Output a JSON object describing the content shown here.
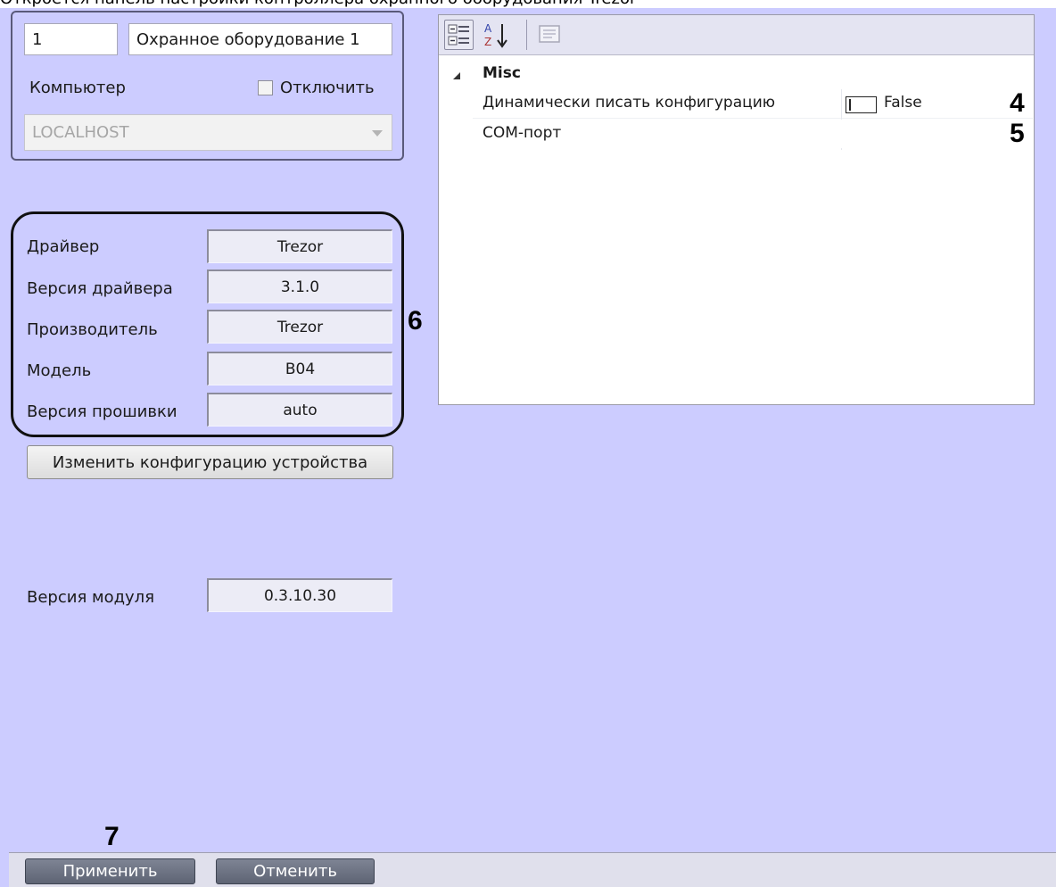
{
  "header_caption": "Откроется панель настройки контроллера охранного оборудования Trezor",
  "device": {
    "id": "1",
    "name": "Охранное оборудование 1",
    "computer_label": "Компьютер",
    "disable_label": "Отключить",
    "computer_value": "LOCALHOST"
  },
  "info": {
    "rows": [
      {
        "label": "Драйвер",
        "value": "Trezor"
      },
      {
        "label": "Версия драйвера",
        "value": "3.1.0"
      },
      {
        "label": "Производитель",
        "value": "Trezor"
      },
      {
        "label": "Модель",
        "value": "B04"
      },
      {
        "label": "Версия прошивки",
        "value": "auto"
      }
    ]
  },
  "change_config_button": "Изменить конфигурацию устройства",
  "module_version": {
    "label": "Версия модуля",
    "value": "0.3.10.30"
  },
  "property_grid": {
    "category": "Misc",
    "props": [
      {
        "name": "Динамически писать конфигурацию",
        "value": "False"
      },
      {
        "name": "COM-порт",
        "value": ""
      }
    ]
  },
  "callouts": {
    "c4": "4",
    "c5": "5",
    "c6": "6",
    "c7": "7"
  },
  "footer": {
    "apply": "Применить",
    "cancel": "Отменить"
  },
  "icons": {
    "categorized": "categorized-view-icon",
    "alphabetical": "sort-az-icon",
    "pages": "property-pages-icon"
  }
}
